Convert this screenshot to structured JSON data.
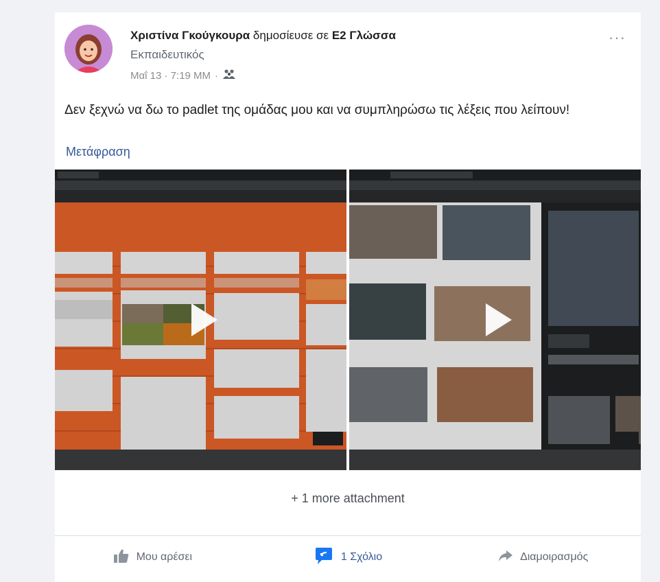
{
  "post": {
    "author": "Χριστίνα Γκούγκουρα",
    "verb": "δημοσίευσε σε",
    "group": "Ε2 Γλώσσα",
    "role": "Εκπαιδευτικός",
    "date": "Μαΐ 13 · 7:19 ΜΜ",
    "separator": "·",
    "text": "Δεν ξεχνώ να δω το padlet της ομάδας μου και να συμπληρώσω τις λέξεις που λείπουν!",
    "translate": "Μετάφραση",
    "more_menu": "···"
  },
  "attachments": {
    "more": "+ 1 more attachment"
  },
  "actions": {
    "like": "Μου αρέσει",
    "comment": "1 Σχόλιο",
    "share": "Διαμοιρασμός"
  },
  "colors": {
    "link": "#385898",
    "padlet_orange": "#e8632b"
  }
}
